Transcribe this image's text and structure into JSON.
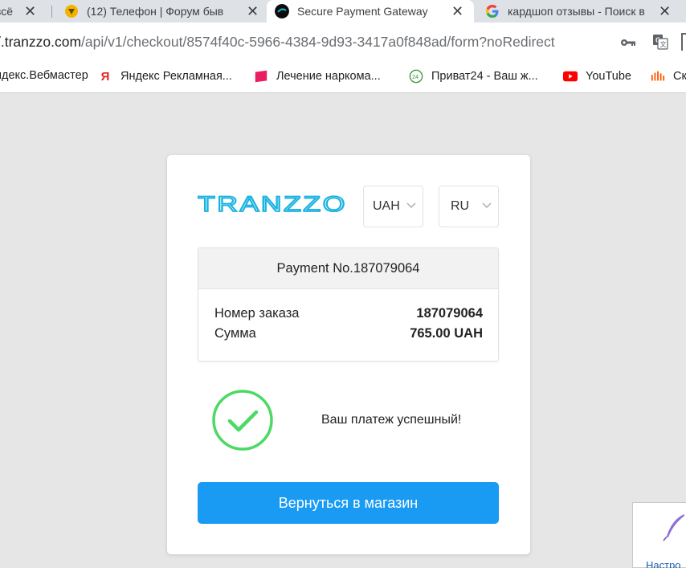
{
  "browser": {
    "tabs": [
      {
        "title": "всё",
        "active": false
      },
      {
        "title": "(12) Телефон | Форум быв",
        "active": false
      },
      {
        "title": "Secure Payment Gateway",
        "active": true
      },
      {
        "title": "кардшоп отзывы - Поиск в",
        "active": false
      }
    ],
    "url_host": "/.tranzzo.com",
    "url_path": "/api/v1/checkout/8574f40c-5966-4384-9d93-3417a0f848ad/form?noRedirect",
    "bookmarks": [
      {
        "label": "ндекс.Вебмастер",
        "icon": "yandex-webmaster-icon"
      },
      {
        "label": "Яндекс Рекламная...",
        "icon": "yandex-icon"
      },
      {
        "label": "Лечение наркома...",
        "icon": "pink-site-icon"
      },
      {
        "label": "Приват24 - Ваш ж...",
        "icon": "privat24-icon"
      },
      {
        "label": "YouTube",
        "icon": "youtube-icon"
      },
      {
        "label": "Ск",
        "icon": "soundcloud-icon"
      }
    ]
  },
  "checkout": {
    "logo_text": "TRANZZO",
    "currency": "UAH",
    "language": "RU",
    "payment_title": "Payment No.187079064",
    "order_label": "Номер заказа",
    "order_value": "187079064",
    "amount_label": "Сумма",
    "amount_value": "765.00 UAH",
    "status_text": "Ваш платеж успешный!",
    "return_button": "Вернуться в магазин"
  },
  "corner_widget": {
    "label": "Настро"
  },
  "colors": {
    "brand": "#1ab3e0",
    "button": "#1a9bf3",
    "success": "#4cd964",
    "page_bg": "#e6e6e6"
  }
}
